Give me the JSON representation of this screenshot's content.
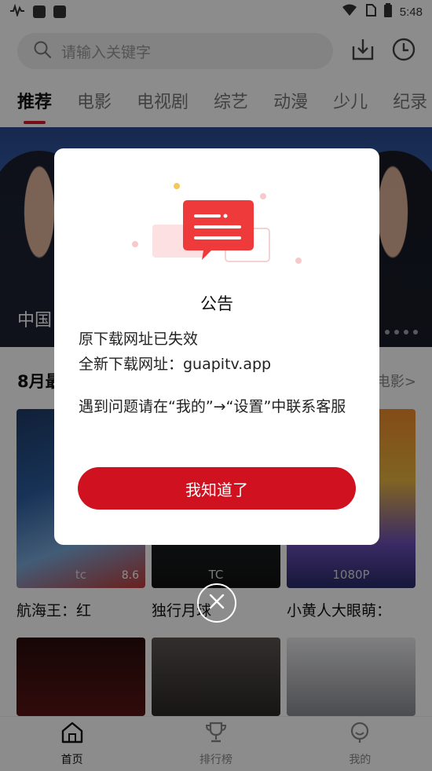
{
  "status_bar": {
    "time": "5:48"
  },
  "search": {
    "placeholder": "请输入关键字"
  },
  "tabs": [
    {
      "label": "推荐",
      "active": true
    },
    {
      "label": "电影"
    },
    {
      "label": "电视剧"
    },
    {
      "label": "综艺"
    },
    {
      "label": "动漫"
    },
    {
      "label": "少儿"
    },
    {
      "label": "纪录"
    }
  ],
  "banner": {
    "title": "中国"
  },
  "section": {
    "title": "8月最",
    "more": "电影>"
  },
  "movies": [
    {
      "title": "航海王：红",
      "badge": "8.6",
      "tag": "tc"
    },
    {
      "title": "独行月球",
      "tag": "TC"
    },
    {
      "title": "小黄人大眼萌：",
      "tag": "1080P"
    }
  ],
  "nav": [
    {
      "label": "首页",
      "icon": "home-icon",
      "active": true
    },
    {
      "label": "排行榜",
      "icon": "trophy-icon"
    },
    {
      "label": "我的",
      "icon": "profile-icon"
    }
  ],
  "dialog": {
    "title": "公告",
    "line1": "原下载网址已失效",
    "line2": "全新下载网址：guapitv.app",
    "line3": "遇到问题请在“我的”→“设置”中联系客服",
    "button": "我知道了"
  },
  "colors": {
    "accent": "#d0111f",
    "overlay": "rgba(0,0,0,0.45)"
  }
}
